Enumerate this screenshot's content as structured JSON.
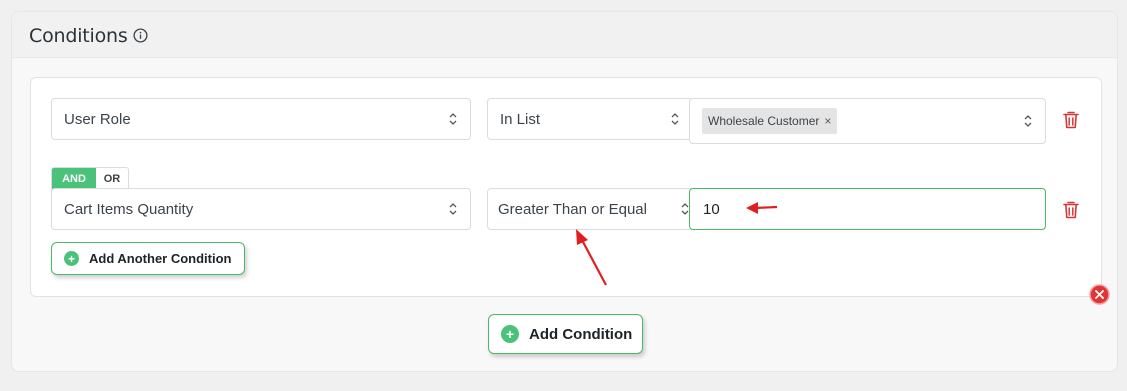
{
  "panel": {
    "title": "Conditions"
  },
  "conditions": [
    {
      "field": "User Role",
      "operator": "In List",
      "tags": [
        "Wholesale Customer"
      ]
    },
    {
      "field": "Cart Items Quantity",
      "operator": "Greater Than or Equal",
      "value": "10"
    }
  ],
  "logic_toggle": {
    "and_label": "AND",
    "or_label": "OR",
    "selected": "AND"
  },
  "buttons": {
    "add_another_condition": "Add Another Condition",
    "add_condition": "Add Condition"
  },
  "colors": {
    "accent_green": "#4ac27a",
    "delete_red": "#d63638",
    "annotation_arrow": "#e02020"
  },
  "icons": {
    "info": "info-icon",
    "chevron": "chevron-updown-icon",
    "trash": "trash-icon",
    "remove_tag": "close-icon",
    "plus": "plus-circle-icon",
    "remove_group": "close-circle-icon"
  }
}
